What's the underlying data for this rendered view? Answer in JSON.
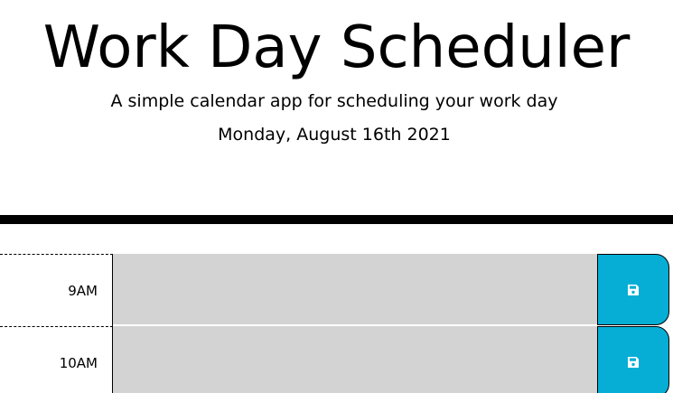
{
  "header": {
    "title": "Work Day Scheduler",
    "lead": "A simple calendar app for scheduling your work day",
    "current_day": "Monday, August 16th 2021"
  },
  "colors": {
    "past": "#d3d3d3",
    "save_button": "#06aed5"
  },
  "time_blocks": [
    {
      "hour": "9AM",
      "description": "",
      "save_icon": "save-icon"
    },
    {
      "hour": "10AM",
      "description": "",
      "save_icon": "save-icon"
    }
  ]
}
